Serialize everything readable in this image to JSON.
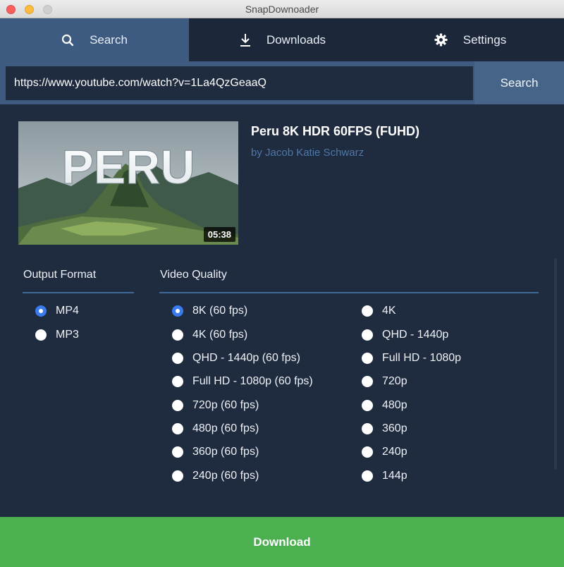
{
  "window": {
    "title": "SnapDownoader"
  },
  "tabs": [
    {
      "label": "Search",
      "icon": "search-icon",
      "active": true
    },
    {
      "label": "Downloads",
      "icon": "download-icon",
      "active": false
    },
    {
      "label": "Settings",
      "icon": "gear-icon",
      "active": false
    }
  ],
  "search": {
    "url": "https://www.youtube.com/watch?v=1La4QzGeaaQ",
    "button_label": "Search"
  },
  "video": {
    "title": "Peru 8K HDR 60FPS (FUHD)",
    "author": "by Jacob Katie Schwarz",
    "duration": "05:38",
    "thumbnail_text": "PERU"
  },
  "output_format": {
    "label": "Output Format",
    "options": [
      "MP4",
      "MP3"
    ],
    "selected": "MP4"
  },
  "video_quality": {
    "label": "Video Quality",
    "options_left": [
      "8K (60 fps)",
      "4K (60 fps)",
      "QHD - 1440p (60 fps)",
      "Full HD - 1080p (60 fps)",
      "720p (60 fps)",
      "480p (60 fps)",
      "360p (60 fps)",
      "240p (60 fps)"
    ],
    "options_right": [
      "4K",
      "QHD - 1440p",
      "Full HD - 1080p",
      "720p",
      "480p",
      "360p",
      "240p",
      "144p"
    ],
    "selected": "8K (60 fps)"
  },
  "download": {
    "button_label": "Download"
  },
  "colors": {
    "background": "#1f2b3e",
    "accent": "#3d5a80",
    "link": "#4f78a8",
    "download": "#4caf50",
    "radio_selected": "#3a7bf0"
  }
}
